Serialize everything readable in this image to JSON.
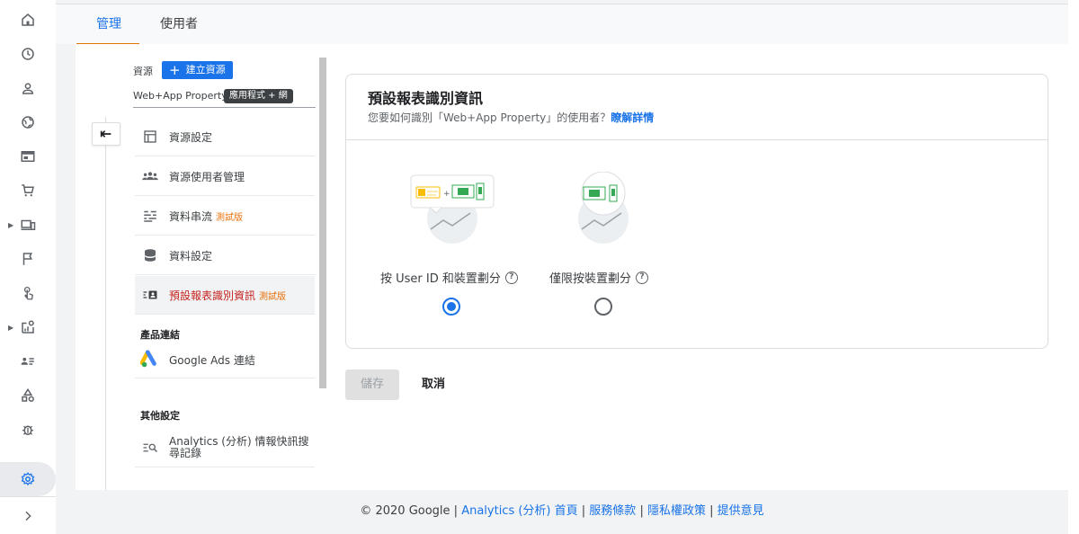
{
  "tabs": [
    {
      "label": "管理",
      "active": true
    },
    {
      "label": "使用者",
      "active": false
    }
  ],
  "admin": {
    "property_label": "資源",
    "create_button": "建立資源",
    "property_name": "Web+App Property",
    "property_badge": "應用程式 + 網",
    "menu": [
      {
        "label": "資源設定",
        "beta": "",
        "icon": "layout-icon"
      },
      {
        "label": "資源使用者管理",
        "beta": "",
        "icon": "people-icon"
      },
      {
        "label": "資料串流",
        "beta": "測試版",
        "icon": "streams-icon"
      },
      {
        "label": "資料設定",
        "beta": "",
        "icon": "database-icon"
      },
      {
        "label": "預設報表識別資訊",
        "beta": "測試版",
        "icon": "reporting-identity-icon"
      }
    ],
    "product_links_heading": "產品連結",
    "google_ads_link": "Google Ads 連結",
    "other_settings_heading": "其他設定",
    "insights_search_history": "Analytics (分析) 情報快訊搜尋記錄"
  },
  "card": {
    "title": "預設報表識別資訊",
    "subtitle": "您要如何識別「Web+App Property」的使用者？",
    "learn_more": "瞭解詳情",
    "options": [
      {
        "label": "按 User ID 和裝置劃分",
        "selected": true
      },
      {
        "label": "僅限按裝置劃分",
        "selected": false
      }
    ]
  },
  "actions": {
    "save": "儲存",
    "cancel": "取消"
  },
  "footer": {
    "copyright": "© 2020 Google | ",
    "links": [
      "Analytics (分析) 首頁",
      "服務條款",
      "隱私權政策",
      "提供意見"
    ],
    "separator": " | "
  },
  "colors": {
    "accent": "#1a73e8",
    "tab_underline": "#e37400",
    "active_menu_text": "#c5221f",
    "beta": "#e8710a"
  }
}
